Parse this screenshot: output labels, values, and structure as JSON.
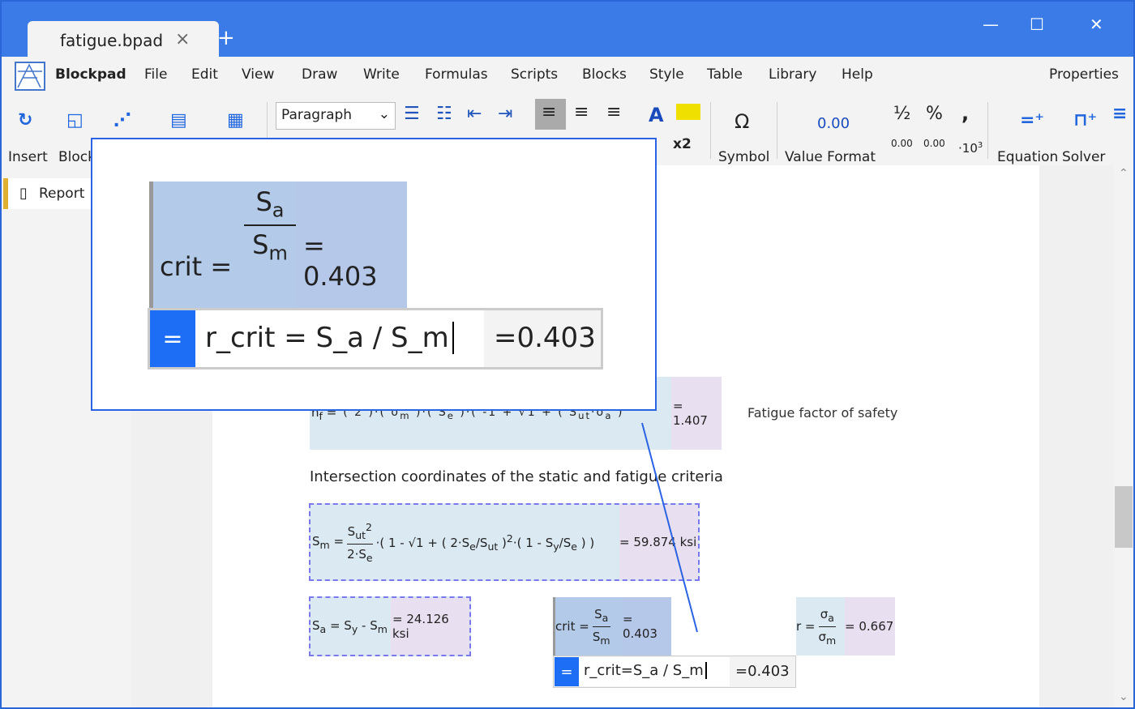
{
  "tab": {
    "title": "fatigue.bpad",
    "close": "×",
    "new": "+"
  },
  "window": {
    "minimize": "—",
    "maximize": "☐",
    "close": "✕"
  },
  "menu": {
    "app": "Blockpad",
    "items": [
      "File",
      "Edit",
      "View",
      "Draw",
      "Write",
      "Formulas",
      "Scripts",
      "Blocks",
      "Style",
      "Table",
      "Library",
      "Help"
    ],
    "properties": "Properties"
  },
  "toolbar": {
    "insert": "Insert",
    "block": "Block",
    "paragraph": "Paragraph",
    "superscript": "x2",
    "symbol": "Symbol",
    "symbol_glyph": "Ω",
    "value_format": "Value Format",
    "value_format_sample": "0.00",
    "half": "½",
    "percent": "%",
    "comma": ",",
    "dec_inc": "0.00",
    "dec_dec": "0.00",
    "sci": "10",
    "equation": "Equation",
    "solver": "Solver"
  },
  "sidebar": {
    "report": "Report"
  },
  "doc": {
    "nf_result": "= 1.407",
    "nf_label": "Fatigue factor of safety",
    "heading": "Intersection coordinates of the static and fatigue criteria",
    "sm_result": "= 59.874 ksi",
    "sa_result": "= 24.126 ksi",
    "rcrit_result": "= 0.403",
    "r_result": "= 0.667",
    "editor_text": "r_crit=S_a / S_m",
    "editor_result": "=0.403",
    "eq_btn": "="
  },
  "popup": {
    "result": "= 0.403",
    "editor_text": "r_crit = S_a / S_m",
    "editor_result": "=0.403",
    "eq_btn": "="
  }
}
